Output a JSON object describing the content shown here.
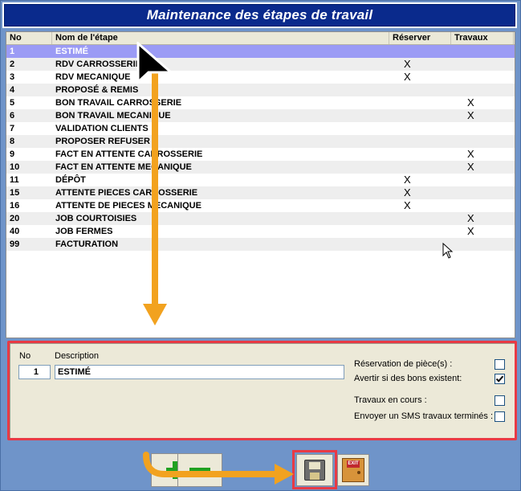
{
  "window": {
    "title": "Maintenance des étapes de travail"
  },
  "list": {
    "columns": {
      "no": "No",
      "name": "Nom de l'étape",
      "reserver": "Réserver",
      "travaux": "Travaux"
    },
    "rows": [
      {
        "no": "1",
        "name": "ESTIMÉ",
        "reserver": "",
        "travaux": "",
        "selected": true
      },
      {
        "no": "2",
        "name": "RDV CARROSSERIE",
        "reserver": "X",
        "travaux": ""
      },
      {
        "no": "3",
        "name": "RDV MECANIQUE",
        "reserver": "X",
        "travaux": ""
      },
      {
        "no": "4",
        "name": "PROPOSÉ & REMIS",
        "reserver": "",
        "travaux": ""
      },
      {
        "no": "5",
        "name": "BON TRAVAIL CARROSSERIE",
        "reserver": "",
        "travaux": "X"
      },
      {
        "no": "6",
        "name": "BON TRAVAIL MECANIQUE",
        "reserver": "",
        "travaux": "X"
      },
      {
        "no": "7",
        "name": "VALIDATION CLIENTS",
        "reserver": "",
        "travaux": ""
      },
      {
        "no": "8",
        "name": "PROPOSER REFUSER",
        "reserver": "",
        "travaux": ""
      },
      {
        "no": "9",
        "name": "FACT EN ATTENTE CARROSSERIE",
        "reserver": "",
        "travaux": "X"
      },
      {
        "no": "10",
        "name": "FACT EN ATTENTE MECANIQUE",
        "reserver": "",
        "travaux": "X"
      },
      {
        "no": "11",
        "name": "DÉPÔT",
        "reserver": "X",
        "travaux": ""
      },
      {
        "no": "15",
        "name": "ATTENTE PIECES CARROSSERIE",
        "reserver": "X",
        "travaux": ""
      },
      {
        "no": "16",
        "name": "ATTENTE DE PIECES MECANIQUE",
        "reserver": "X",
        "travaux": ""
      },
      {
        "no": "20",
        "name": "JOB COURTOISIES",
        "reserver": "",
        "travaux": "X"
      },
      {
        "no": "40",
        "name": "JOB FERMES",
        "reserver": "",
        "travaux": "X"
      },
      {
        "no": "99",
        "name": "FACTURATION",
        "reserver": "",
        "travaux": ""
      }
    ]
  },
  "detail": {
    "no_label": "No",
    "description_label": "Description",
    "no_value": "1",
    "description_value": "ESTIMÉ",
    "options": [
      {
        "label": "Réservation de pièce(s) :",
        "checked": false
      },
      {
        "label": "Avertir si des bons existent:",
        "checked": true
      },
      {
        "label": "Travaux en cours :",
        "checked": false
      },
      {
        "label": "Envoyer un SMS travaux terminés :",
        "checked": false
      }
    ]
  },
  "toolbar": {
    "exit_label": "EXIT"
  },
  "colors": {
    "title_bg": "#0a2a8c",
    "selected_row": "#9b9bf5",
    "highlight": "#e83a45",
    "arrow": "#f2a21f",
    "green": "#21a121"
  },
  "icons": [
    "plus-icon",
    "minus-icon",
    "floppy-disk-icon",
    "exit-door-icon",
    "mouse-cursor-icon",
    "check-icon"
  ]
}
